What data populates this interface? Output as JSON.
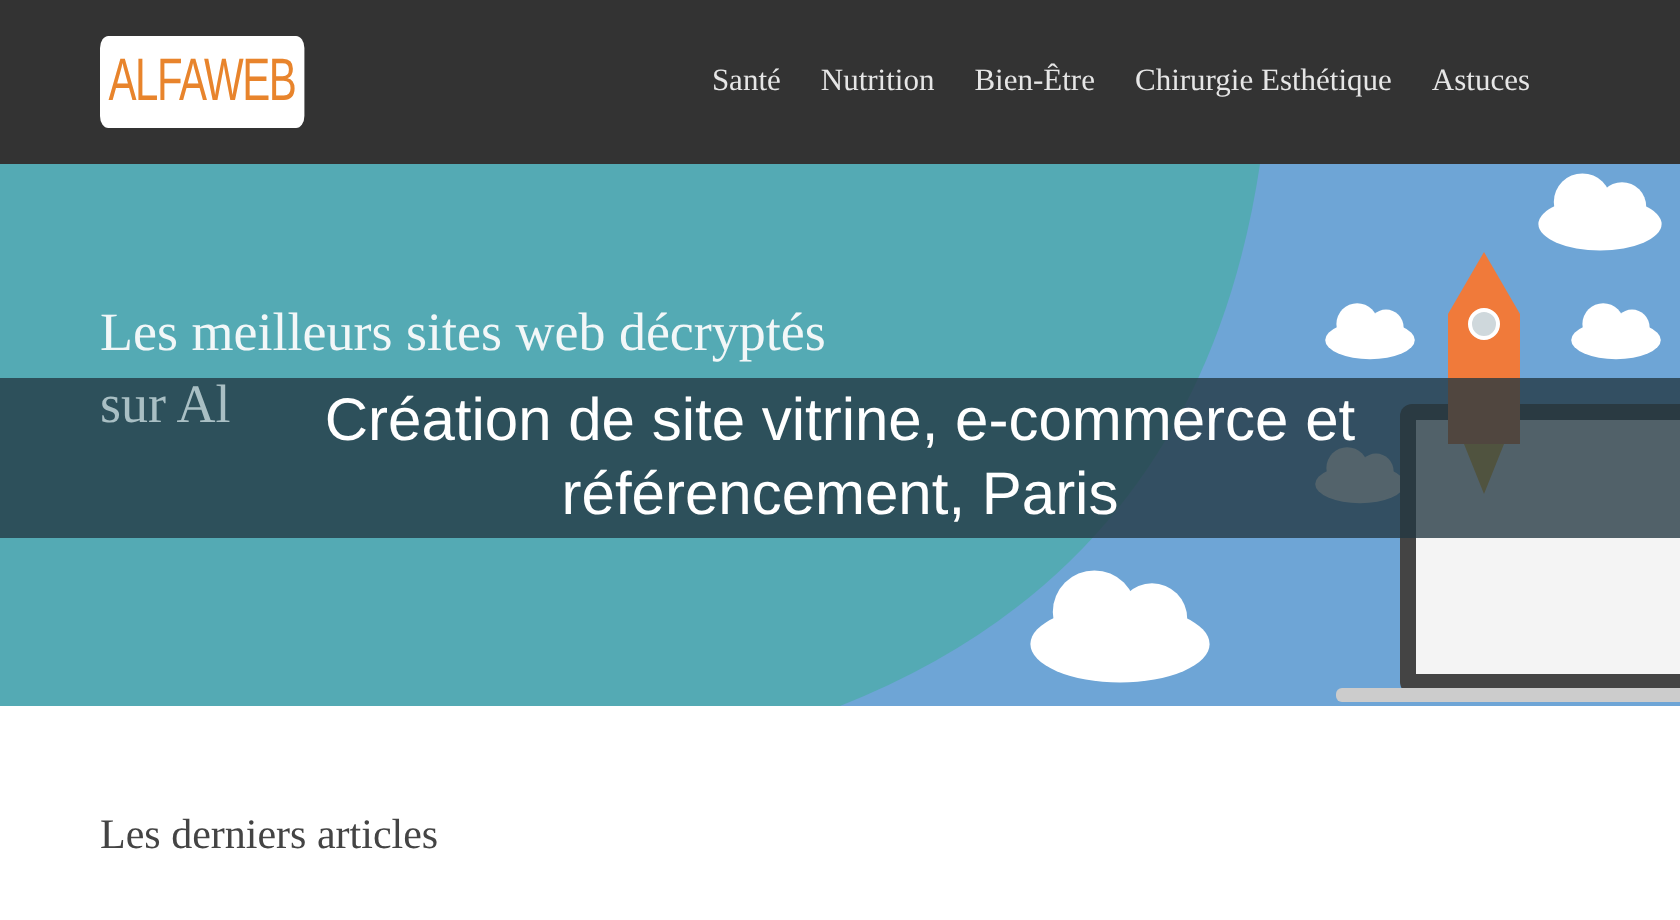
{
  "header": {
    "logo": "ALFAWEB",
    "nav": [
      {
        "label": "Santé"
      },
      {
        "label": "Nutrition"
      },
      {
        "label": "Bien-Être"
      },
      {
        "label": "Chirurgie Esthétique"
      },
      {
        "label": "Astuces"
      }
    ]
  },
  "hero": {
    "title_lines": [
      "Les meilleurs sites web décryptés",
      "sur Al"
    ]
  },
  "caption": {
    "text": "Création de site vitrine, e-commerce et référencement, Paris"
  },
  "section": {
    "heading": "Les derniers articles"
  }
}
